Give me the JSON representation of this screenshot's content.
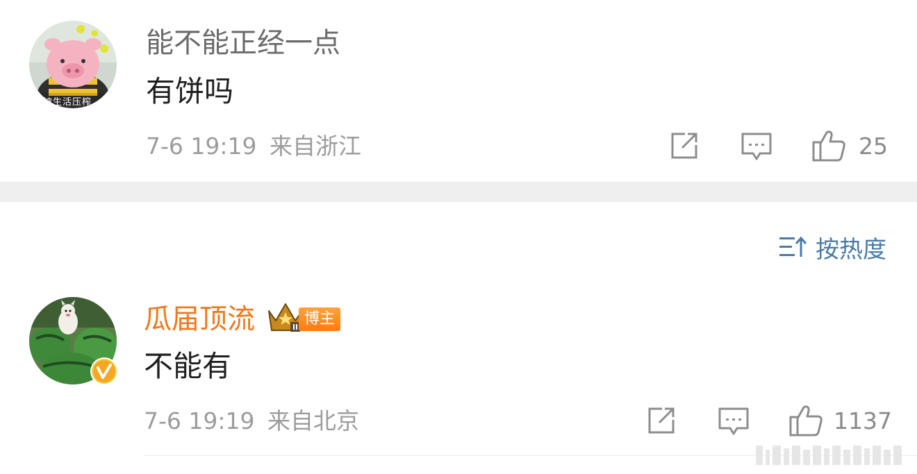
{
  "comments": [
    {
      "username": "能不能正经一点",
      "content": "有饼吗",
      "time": "7-6 19:19",
      "location": "来自浙江",
      "likes": "25",
      "avatar_caption": "被生活压榨"
    },
    {
      "username": "瓜届顶流",
      "badge_label": "博主",
      "content": "不能有",
      "time": "7-6 19:19",
      "location": "来自北京",
      "likes": "1137"
    }
  ],
  "sort": {
    "label": "按热度"
  },
  "icons": {
    "share": "share-icon",
    "comment": "comment-icon",
    "like": "thumbs-up-icon",
    "sort": "sort-icon",
    "crown": "crown-icon",
    "verified": "verified-icon"
  },
  "colors": {
    "username_default": "#6a6a6a",
    "username_highlight": "#f0781e",
    "meta": "#9c9c9c",
    "sort": "#4a7aa9",
    "separator": "#efefef"
  }
}
